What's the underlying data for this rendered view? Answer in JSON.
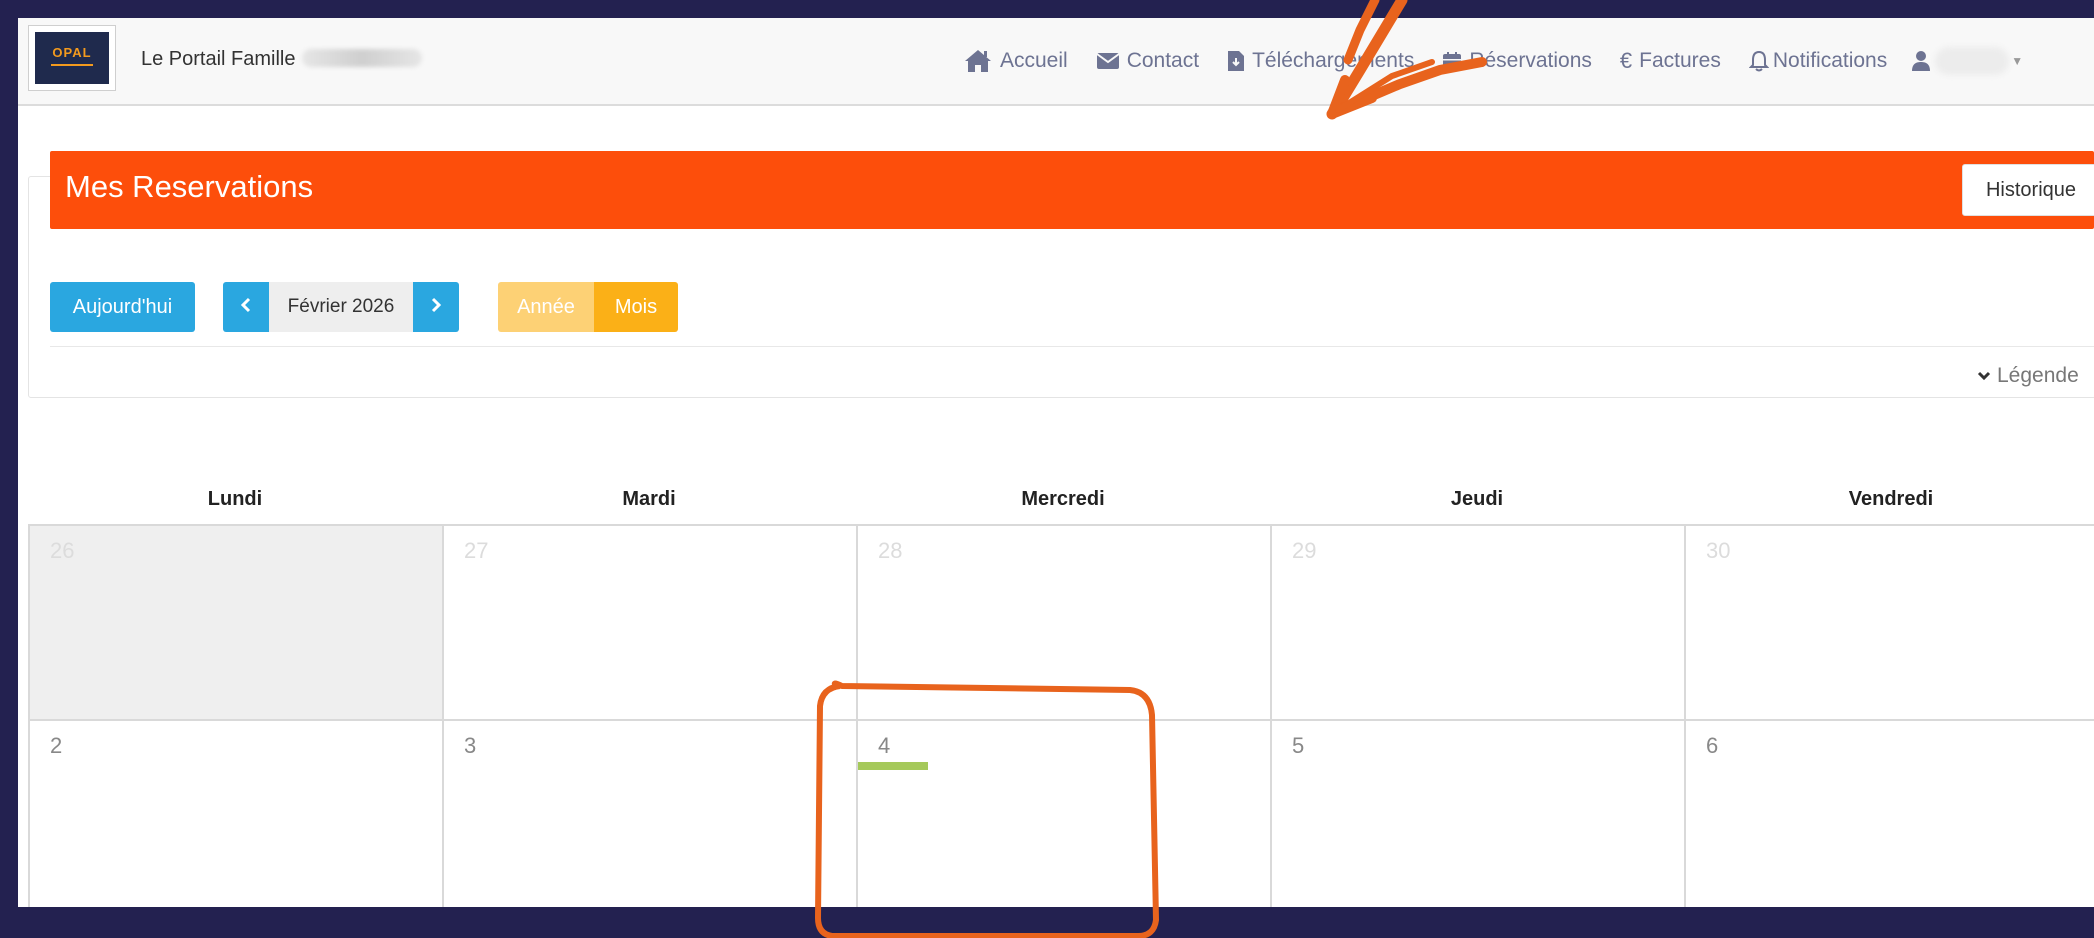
{
  "navbar": {
    "logo_text": "OPAL",
    "brand_title": "Le Portail Famille",
    "links": {
      "accueil": "Accueil",
      "contact": "Contact",
      "telechargements": "Téléchargements",
      "reservations": "Réservations",
      "factures": "Factures",
      "notifications": "Notifications"
    },
    "icons": [
      "home-icon",
      "envelope-icon",
      "file-download-icon",
      "calendar-icon",
      "euro-icon",
      "bell-icon",
      "user-icon",
      "caret-down-icon"
    ]
  },
  "page": {
    "title": "Mes Reservations",
    "historique_label": "Historique"
  },
  "toolbar": {
    "today_label": "Aujourd'hui",
    "period_label": "Février 2026",
    "view_year_label": "Année",
    "view_month_label": "Mois",
    "active_view": "Mois"
  },
  "legend": {
    "label": "Légende"
  },
  "calendar": {
    "weekdays": [
      "Lundi",
      "Mardi",
      "Mercredi",
      "Jeudi",
      "Vendredi"
    ],
    "week1": [
      "26",
      "27",
      "28",
      "29",
      "30"
    ],
    "week2": [
      "2",
      "3",
      "4",
      "5",
      "6"
    ]
  },
  "colors": {
    "accent_orange": "#fd4e0b",
    "primary_blue": "#2aa7e0",
    "view_active": "#fbb017",
    "view_inactive": "#fdd175",
    "event_green": "#a5c95a",
    "annotation": "#e8631d",
    "frame": "#232150"
  }
}
